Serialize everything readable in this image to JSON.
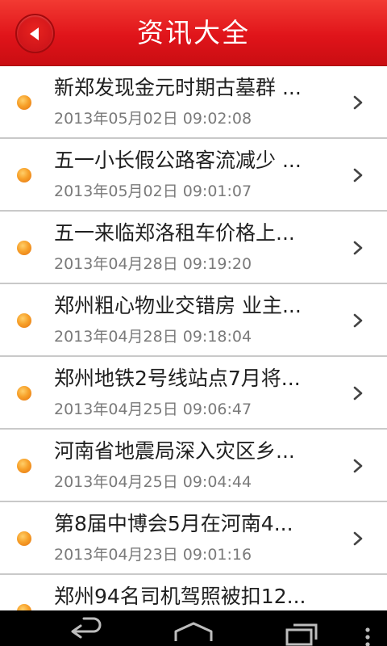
{
  "header": {
    "title": "资讯大全",
    "back_icon": "back-arrow-icon",
    "accent_color": "#e0141a"
  },
  "news": [
    {
      "title": "新郑发现金元时期古墓群 ...",
      "date": "2013年05月02日 09:02:08"
    },
    {
      "title": "五一小长假公路客流减少 ...",
      "date": "2013年05月02日 09:01:07"
    },
    {
      "title": "五一来临郑洛租车价格上...",
      "date": "2013年04月28日 09:19:20"
    },
    {
      "title": "郑州粗心物业交错房 业主...",
      "date": "2013年04月28日 09:18:04"
    },
    {
      "title": "郑州地铁2号线站点7月将...",
      "date": "2013年04月25日 09:06:47"
    },
    {
      "title": "河南省地震局深入灾区乡...",
      "date": "2013年04月25日 09:04:44"
    },
    {
      "title": "第8届中博会5月在河南4...",
      "date": "2013年04月23日 09:01:16"
    },
    {
      "title": "郑州94名司机驾照被扣12...",
      "date": ""
    }
  ],
  "navbar": {
    "back_icon": "back-icon",
    "home_icon": "home-icon",
    "recents_icon": "recent-apps-icon",
    "menu_icon": "overflow-menu-icon"
  }
}
